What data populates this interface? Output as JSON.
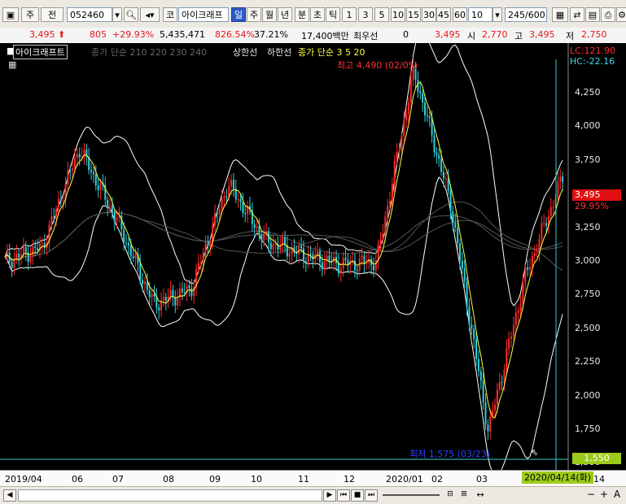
{
  "toolbar": {
    "period_label": "주",
    "prev_label": "전",
    "code_value": "052460",
    "market_label": "코",
    "stock_name": "아이크래프",
    "tab_day": "일",
    "tab_week": "주",
    "tab_month": "월",
    "tab_year": "년",
    "tab_min": "분",
    "tab_tick_cho": "초",
    "tab_tick": "틱",
    "intervals": [
      "1",
      "3",
      "5",
      "10",
      "15",
      "30",
      "45",
      "60"
    ],
    "interval_value": "10",
    "count_value": "245",
    "count_max": "/600"
  },
  "infobar": {
    "price": "3,495",
    "change": "805",
    "change_pct": "+29.93%",
    "volume": "5,435,471",
    "vol_ratio": "826.54%",
    "turnover": "37.21%",
    "amount": "17,400백만",
    "lowest_label": "최우선",
    "lowest_value": "0",
    "cur": "3,495",
    "open_label": "시",
    "open": "2,770",
    "high_label": "고",
    "high": "3,495",
    "low_label": "저",
    "low": "2,750"
  },
  "chart": {
    "stock_label": "아이크래프트",
    "ma_legend": "종가 단순 210 220 230 240",
    "upper_limit": "상한선",
    "lower_limit": "하한선",
    "ma_short_legend": "종가 단순 3 5 20",
    "lc": "LC:121.90",
    "hc": "HC:-22.16",
    "high_annot": "최고 4,490 (02/05)",
    "low_annot": "최저 1,575 (03/23)",
    "current_price": "3,495",
    "current_pct": "29.95%",
    "cursor_price": "1,550",
    "cursor_date": "2020/04/14(화)",
    "y_ticks": [
      "4,250",
      "4,000",
      "3,750",
      "3,500",
      "3,250",
      "3,000",
      "2,750",
      "2,500",
      "2,250",
      "2,000",
      "1,750",
      "1,500"
    ],
    "x_ticks": [
      "2019/04",
      "06",
      "07",
      "08",
      "09",
      "10",
      "11",
      "12",
      "2020/01",
      "02",
      "03",
      "14"
    ],
    "colors": {
      "up": "#ff2a2a",
      "down": "#2fd0d8",
      "ma": "#ffff40",
      "band": "#ffffff",
      "cross": "#33cccc",
      "current_bg": "#e01010",
      "cursor_bg": "#9ccc1a"
    }
  },
  "chart_data": {
    "type": "line",
    "title": "",
    "ylim": [
      1500,
      4400
    ],
    "x": [
      "2019/04",
      "06",
      "07",
      "08",
      "09",
      "10",
      "11",
      "12",
      "2020/01",
      "02",
      "03",
      "2020/04/14"
    ],
    "series": [
      {
        "values": [
          2900,
          3000,
          3700,
          3200,
          2600,
          2700,
          3450,
          3050,
          2950,
          2880,
          2900,
          4250,
          3300,
          1700,
          2800,
          3495
        ]
      }
    ]
  }
}
